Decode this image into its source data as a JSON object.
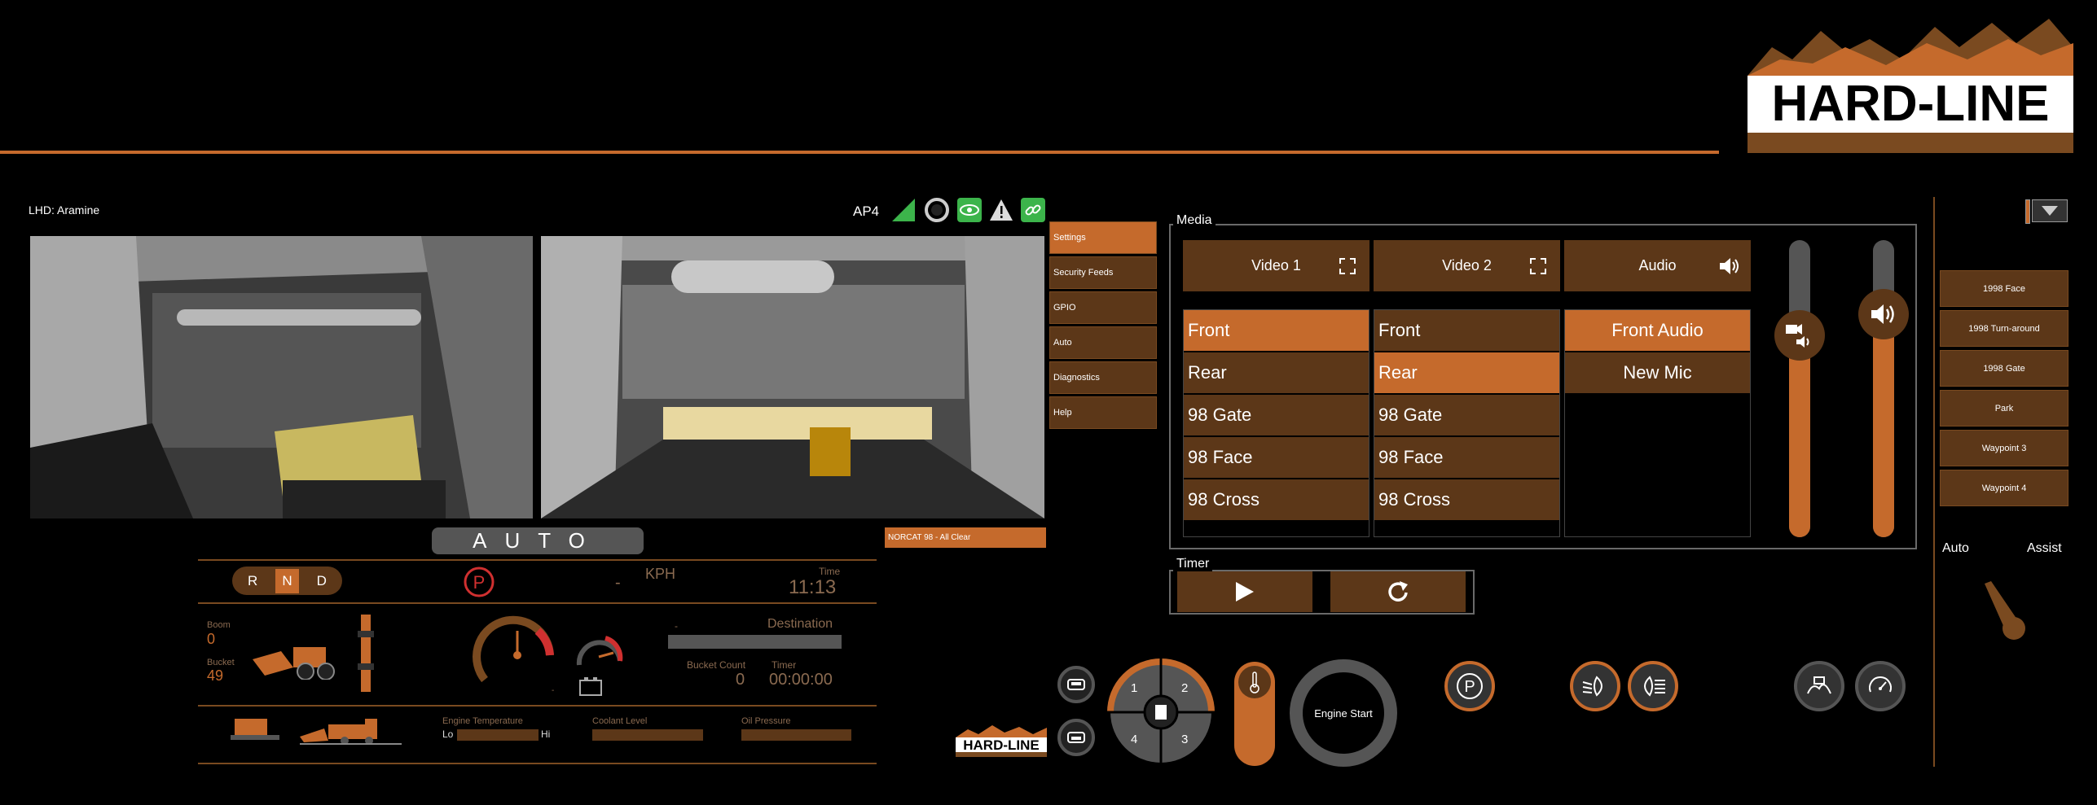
{
  "header": {
    "logo_text": "HARD-LINE",
    "vehicle_label": "LHD: Aramine",
    "access_point": "AP4"
  },
  "status_icons": [
    "signal-icon",
    "circle-status-icon",
    "eye-icon",
    "warning-icon",
    "link-icon"
  ],
  "side_menu": {
    "items": [
      "Settings",
      "Security Feeds",
      "GPIO",
      "Auto",
      "Diagnostics",
      "Help"
    ],
    "active": "Settings"
  },
  "notification": "NORCAT 98 - All Clear",
  "dashboard": {
    "mode": "AUTO",
    "gears": [
      "R",
      "N",
      "D"
    ],
    "selected_gear": "N",
    "speed_value": "-",
    "speed_unit": "KPH",
    "time_label": "Time",
    "time_value": "11:13",
    "boom_label": "Boom",
    "boom_value": "0",
    "bucket_label": "Bucket",
    "bucket_value": "49",
    "destination_prefix": "-",
    "destination_label": "Destination",
    "bucket_count_label": "Bucket Count",
    "bucket_count_value": "0",
    "timer_label": "Timer",
    "timer_value": "00:00:00",
    "rpm_gauge_dash": "-",
    "engine_temp_label": "Engine Temperature",
    "engine_temp_lo": "Lo",
    "engine_temp_hi": "Hi",
    "coolant_label": "Coolant Level",
    "oil_label": "Oil Pressure"
  },
  "media": {
    "title": "Media",
    "headers": [
      "Video 1",
      "Video 2",
      "Audio"
    ],
    "video1": {
      "options": [
        "Front",
        "Rear",
        "98 Gate",
        "98 Face",
        "98 Cross"
      ],
      "selected": "Front"
    },
    "video2": {
      "options": [
        "Front",
        "Rear",
        "98 Gate",
        "98 Face",
        "98 Cross"
      ],
      "selected": "Rear"
    },
    "audio": {
      "options": [
        "Front Audio",
        "New Mic"
      ],
      "selected": "Front Audio"
    },
    "camera_volume_level": 0.68,
    "master_volume_level": 0.75
  },
  "timer": {
    "title": "Timer"
  },
  "camera_selector": {
    "labels": [
      "1",
      "2",
      "4",
      "3"
    ]
  },
  "engine_start_label": "Engine Start",
  "waypoints": [
    "1998 Face",
    "1998 Turn-around",
    "1998 Gate",
    "Park",
    "Waypoint 3",
    "Waypoint 4"
  ],
  "auto_assist": {
    "auto_label": "Auto",
    "assist_label": "Assist"
  },
  "colors": {
    "accent": "#c56a2c",
    "panel": "#5c3718",
    "background": "#000000"
  }
}
